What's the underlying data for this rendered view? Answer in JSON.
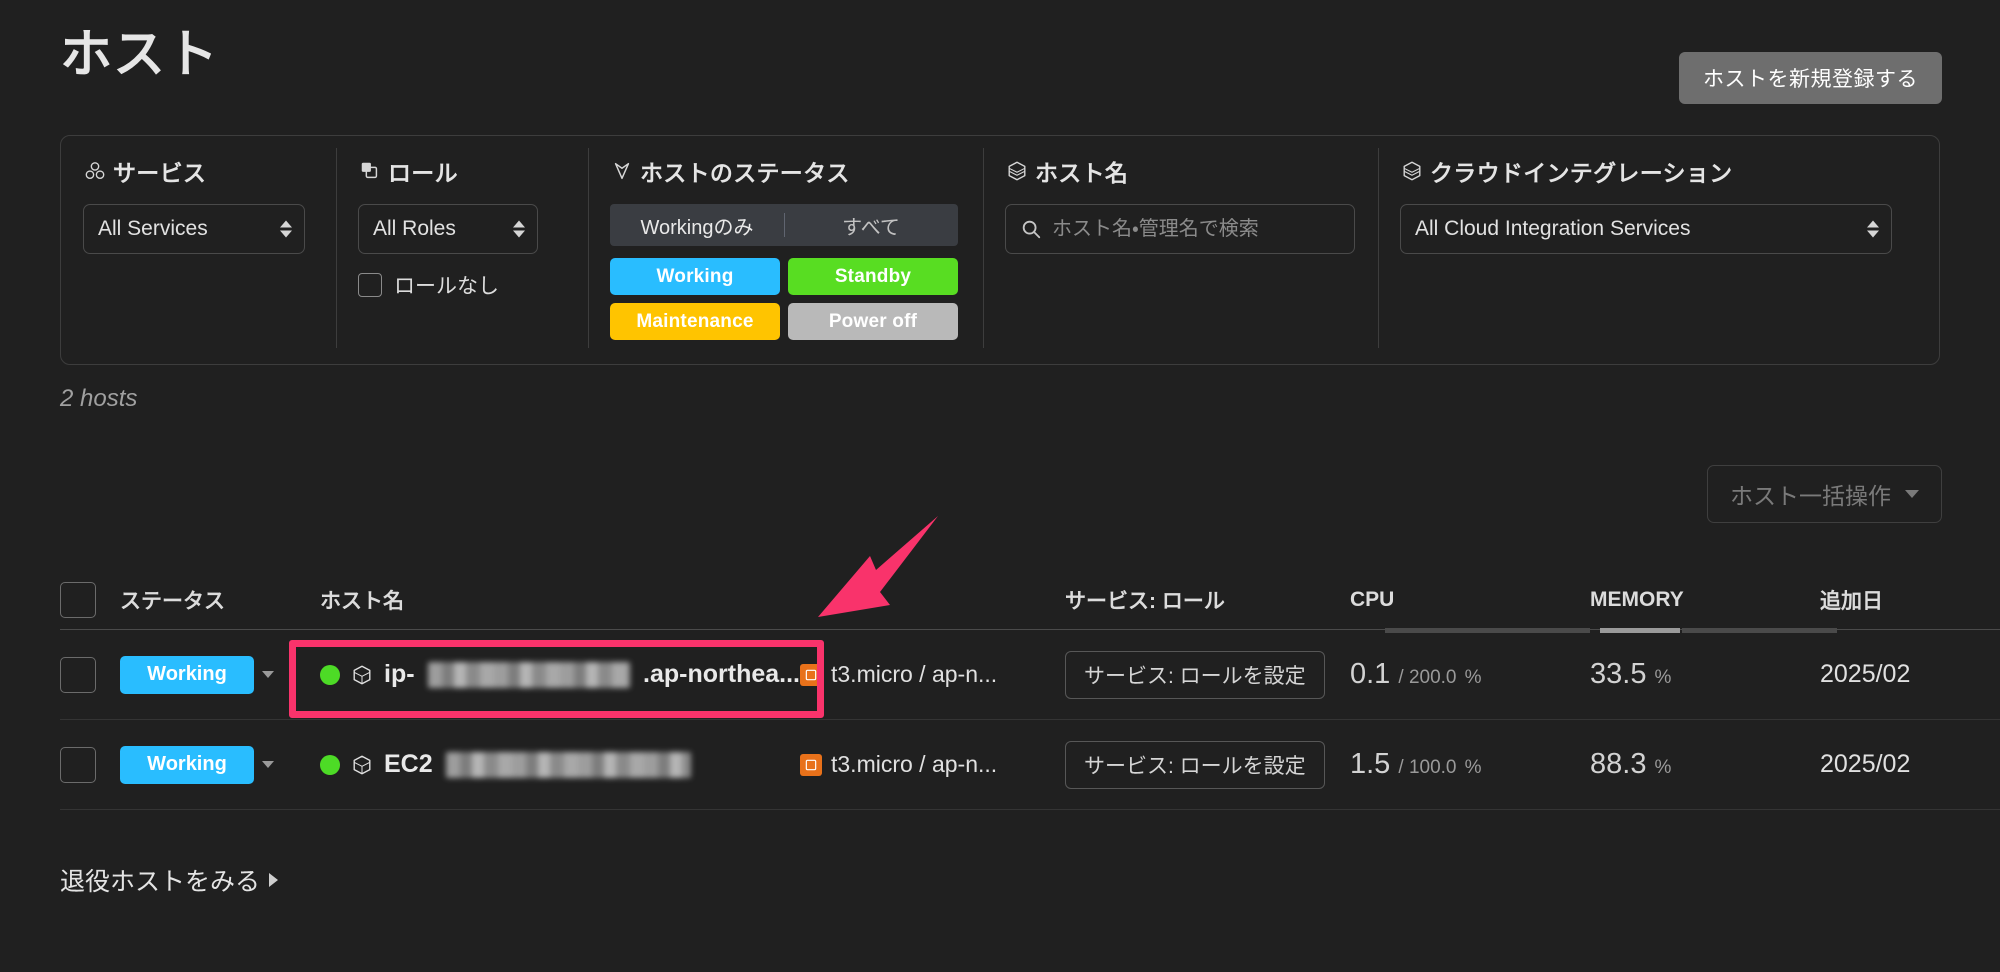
{
  "header": {
    "title": "ホスト",
    "register_button": "ホストを新規登録する"
  },
  "filters": {
    "service": {
      "label": "サービス",
      "icon": "service-icon",
      "selected": "All Services"
    },
    "role": {
      "label": "ロール",
      "icon": "role-icon",
      "selected": "All Roles",
      "no_role_label": "ロールなし",
      "no_role_checked": false
    },
    "host_status": {
      "label": "ホストのステータス",
      "icon": "status-icon",
      "segments": [
        {
          "label": "Workingのみ",
          "active": true
        },
        {
          "label": "すべて",
          "active": false
        }
      ],
      "chips": [
        {
          "label": "Working",
          "bg": "#29bdff",
          "fg": "#ffffff"
        },
        {
          "label": "Standby",
          "bg": "#58dd22",
          "fg": "#ffffff"
        },
        {
          "label": "Maintenance",
          "bg": "#ffc400",
          "fg": "#ffffff"
        },
        {
          "label": "Power off",
          "bg": "#b9b9b9",
          "fg": "#ffffff"
        }
      ]
    },
    "hostname": {
      "label": "ホスト名",
      "icon": "host-cube-icon",
      "value": "",
      "placeholder": "ホスト名・管理名で検索"
    },
    "cloud_integration": {
      "label": "クラウドインテグレーション",
      "icon": "host-cube-icon",
      "selected": "All Cloud Integration Services"
    }
  },
  "list": {
    "count_text": "2 hosts",
    "bulk_button": "ホスト一括操作",
    "retired_link": "退役ホストをみる"
  },
  "table": {
    "columns": {
      "status": "ステータス",
      "hostname": "ホスト名",
      "service_role": "サービス: ロール",
      "cpu": "CPU",
      "memory": "MEMORY",
      "date": "追加日"
    },
    "rows": [
      {
        "status": "Working",
        "hostname_prefix": "ip-",
        "hostname_suffix": ".ap-northea...",
        "hostname_redacted": true,
        "cloud": "t3.micro / ap-n...",
        "cloud_icon": "aws-ec2-icon",
        "set_role_button": "サービス: ロールを設定",
        "cpu_value": "0.1",
        "cpu_max": "/ 200.0",
        "cpu_unit": "%",
        "memory_value": "33.5",
        "memory_unit": "%",
        "date": "2025/02"
      },
      {
        "status": "Working",
        "hostname_prefix": "EC2",
        "hostname_suffix": "",
        "hostname_redacted": true,
        "cloud": "t3.micro / ap-n...",
        "cloud_icon": "aws-ec2-icon",
        "set_role_button": "サービス: ロールを設定",
        "cpu_value": "1.5",
        "cpu_max": "/ 100.0",
        "cpu_unit": "%",
        "memory_value": "88.3",
        "memory_unit": "%",
        "date": "2025/02"
      }
    ]
  },
  "annotations": {
    "highlight_color": "#f9336b",
    "arrow_color": "#f9336b"
  }
}
